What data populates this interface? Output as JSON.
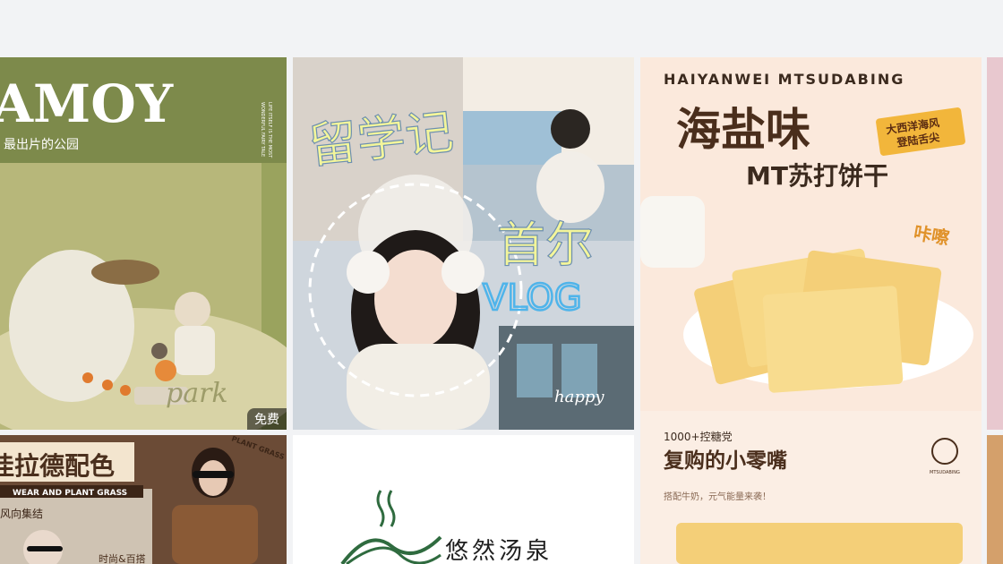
{
  "cards": [
    {
      "title": "AMOY",
      "subtitle": "最出片的公园",
      "side_text_1": "LIFE ITSELF IS THE MOST",
      "side_text_2": "WONDERFUL FAIRY TALE",
      "script_word": "park",
      "badge": "免费"
    },
    {
      "title_1": "留学记",
      "title_2": "首尔",
      "title_3": "VLOG",
      "script_word": "happy"
    },
    {
      "brand": "HAIYANWEI MTSUDABING",
      "headline": "海盐味",
      "sticker_1": "大西洋海风",
      "sticker_2": "登陆舌尖",
      "product": "MT苏打饼干",
      "crisp": "咔嚓",
      "note": "1000+控糖党",
      "tagline": "复购的小零嘴",
      "sub": "搭配牛奶，元气能量来袭！",
      "logo_text": "MTSUDABING"
    },
    {
      "headline": "佳拉德配色",
      "banner": "WEAR AND PLANT GRASS",
      "sub": "风向集结",
      "tag": "时尚&百搭",
      "corner": "PLANT GRASS"
    },
    {
      "name": "悠然汤泉"
    }
  ]
}
